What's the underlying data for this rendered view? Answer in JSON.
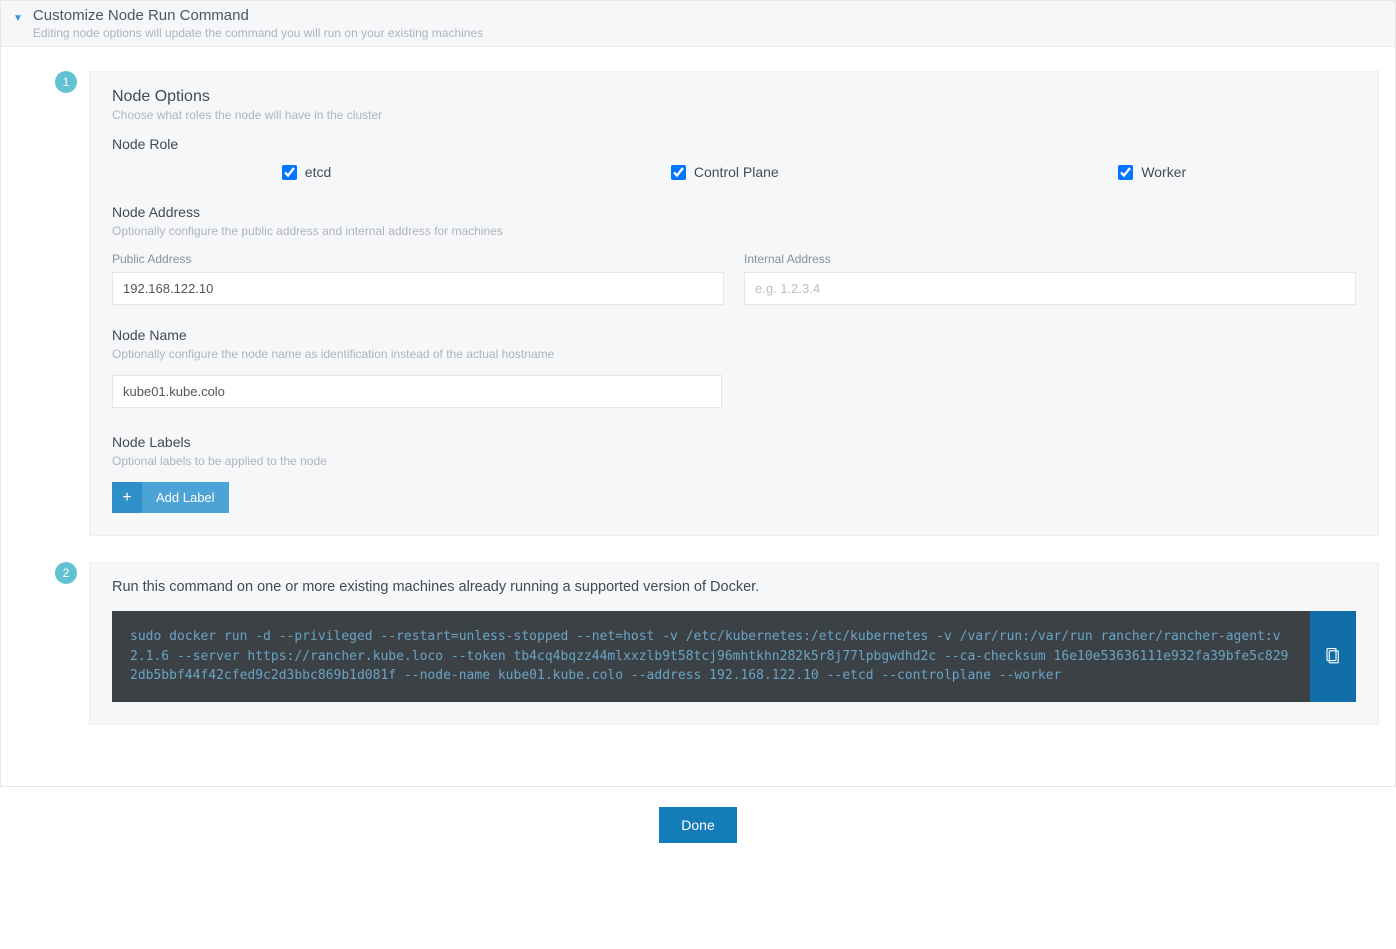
{
  "header": {
    "title": "Customize Node Run Command",
    "subtitle": "Editing node options will update the command you will run on your existing machines"
  },
  "step1": {
    "badge": "1",
    "title": "Node Options",
    "subtitle": "Choose what roles the node will have in the cluster",
    "node_role_label": "Node Role",
    "roles": {
      "etcd": "etcd",
      "control_plane": "Control Plane",
      "worker": "Worker"
    },
    "node_address": {
      "title": "Node Address",
      "subtitle": "Optionally configure the public address and internal address for machines",
      "public_label": "Public Address",
      "public_value": "192.168.122.10",
      "internal_label": "Internal Address",
      "internal_value": "",
      "internal_placeholder": "e.g. 1.2.3.4"
    },
    "node_name": {
      "title": "Node Name",
      "subtitle": "Optionally configure the node name as identification instead of the actual hostname",
      "value": "kube01.kube.colo"
    },
    "node_labels": {
      "title": "Node Labels",
      "subtitle": "Optional labels to be applied to the node",
      "add_button": "Add Label"
    }
  },
  "step2": {
    "badge": "2",
    "instruction": "Run this command on one or more existing machines already running a supported version of Docker.",
    "command": "sudo docker run -d --privileged --restart=unless-stopped --net=host -v /etc/kubernetes:/etc/kubernetes -v /var/run:/var/run rancher/rancher-agent:v2.1.6 --server https://rancher.kube.loco --token tb4cq4bqzz44mlxxzlb9t58tcj96mhtkhn282k5r8j77lpbgwdhd2c --ca-checksum 16e10e53636111e932fa39bfe5c8292db5bbf44f42cfed9c2d3bbc869b1d081f --node-name kube01.kube.colo --address 192.168.122.10 --etcd --controlplane --worker"
  },
  "footer": {
    "done": "Done"
  }
}
